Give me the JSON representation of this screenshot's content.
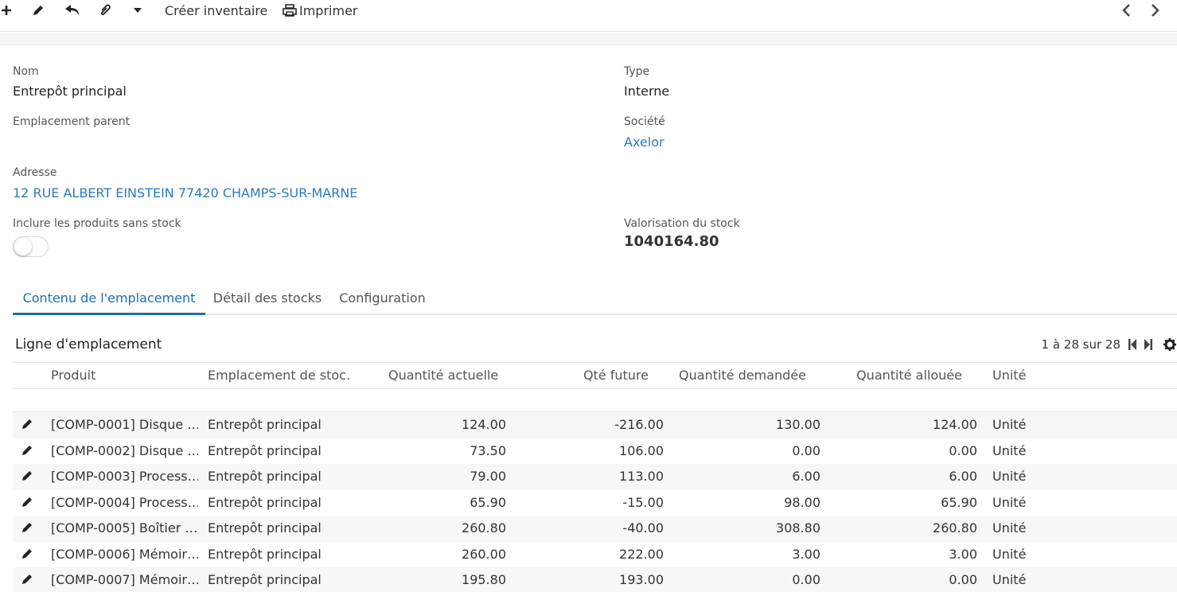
{
  "toolbar": {
    "create_inventory": "Créer inventaire",
    "print": "Imprimer"
  },
  "form": {
    "name_label": "Nom",
    "name_value": "Entrepôt principal",
    "type_label": "Type",
    "type_value": "Interne",
    "parent_label": "Emplacement parent",
    "company_label": "Société",
    "company_value": "Axelor",
    "address_label": "Adresse",
    "address_value": "12 RUE ALBERT EINSTEIN 77420 CHAMPS-SUR-MARNE",
    "include_label": "Inclure les produits sans stock",
    "include_value": false,
    "valuation_label": "Valorisation du stock",
    "valuation_value": "1040164.80"
  },
  "tabs": [
    {
      "label": "Contenu de l'emplacement",
      "active": true
    },
    {
      "label": "Détail des stocks",
      "active": false
    },
    {
      "label": "Configuration",
      "active": false
    }
  ],
  "panel": {
    "title": "Ligne d'emplacement",
    "pager": "1 à 28 sur 28"
  },
  "table": {
    "columns": [
      "Produit",
      "Emplacement de stoc…",
      "Quantité actuelle",
      "Qté future",
      "Quantité demandée",
      "Quantité allouée",
      "Unité"
    ],
    "rows": [
      [
        "[COMP-0001] Disque …",
        "Entrepôt principal",
        "124.00",
        "-216.00",
        "130.00",
        "124.00",
        "Unité"
      ],
      [
        "[COMP-0002] Disque …",
        "Entrepôt principal",
        "73.50",
        "106.00",
        "0.00",
        "0.00",
        "Unité"
      ],
      [
        "[COMP-0003] Process…",
        "Entrepôt principal",
        "79.00",
        "113.00",
        "6.00",
        "6.00",
        "Unité"
      ],
      [
        "[COMP-0004] Process…",
        "Entrepôt principal",
        "65.90",
        "-15.00",
        "98.00",
        "65.90",
        "Unité"
      ],
      [
        "[COMP-0005] Boîtier …",
        "Entrepôt principal",
        "260.80",
        "-40.00",
        "308.80",
        "260.80",
        "Unité"
      ],
      [
        "[COMP-0006] Mémoir…",
        "Entrepôt principal",
        "260.00",
        "222.00",
        "3.00",
        "3.00",
        "Unité"
      ],
      [
        "[COMP-0007] Mémoir…",
        "Entrepôt principal",
        "195.80",
        "193.00",
        "0.00",
        "0.00",
        "Unité"
      ]
    ]
  },
  "icons": {
    "new": "plus-icon",
    "edit": "pencil-icon",
    "undo": "undo-icon",
    "attach": "paperclip-icon",
    "more": "caret-down-icon",
    "print": "printer-icon",
    "prev": "chevron-left-icon",
    "next": "chevron-right-icon",
    "first": "first-page-icon",
    "last": "last-page-icon",
    "settings": "gear-icon"
  }
}
